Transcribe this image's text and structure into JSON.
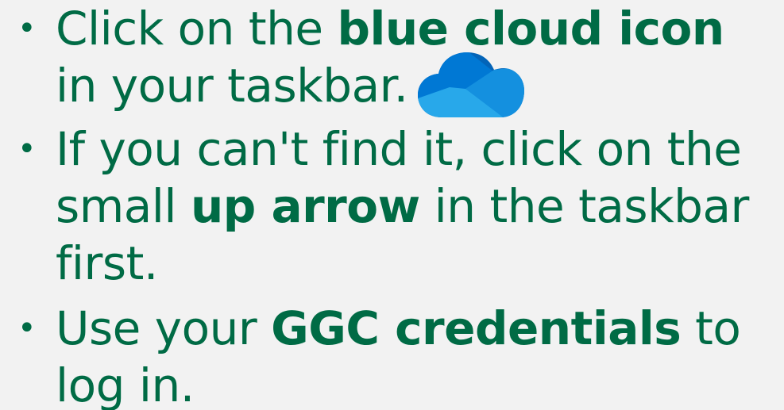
{
  "bullets": [
    {
      "line1_pre": "Click on the ",
      "line1_bold": "blue cloud icon",
      "line2": "in your taskbar.",
      "icon": "onedrive-cloud-icon"
    },
    {
      "line1": "If you can't find it, click on the",
      "line2_pre": "small ",
      "line2_bold": "up arrow",
      "line2_post": " in the taskbar",
      "line3": "first."
    },
    {
      "line1_pre": "Use your ",
      "line1_bold": "GGC credentials",
      "line1_post": " to",
      "line2": "log in."
    }
  ],
  "colors": {
    "text": "#006b45",
    "background": "#f2f2f2",
    "cloud_dark": "#0364b8",
    "cloud_mid": "#0078d4",
    "cloud_light": "#1490df",
    "cloud_lightest": "#28a8ea"
  }
}
